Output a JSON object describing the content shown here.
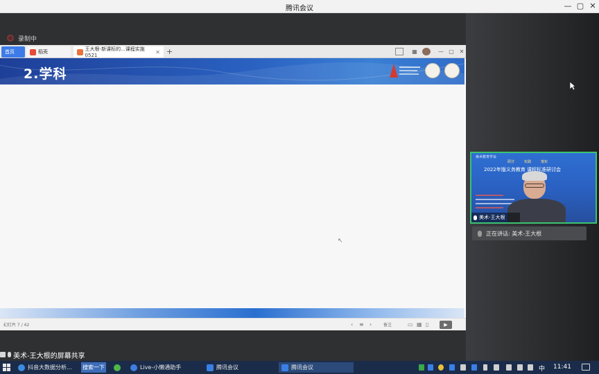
{
  "app": {
    "title": "腾讯会议",
    "controls": {
      "minimize": "—",
      "restore": "▢",
      "close": "✕"
    }
  },
  "meeting": {
    "recording_label": "录制中",
    "sharer_label": "美术-王大根的屏幕共享",
    "speaking_label": "正在讲话: 美术-王大根"
  },
  "browser": {
    "tabs": [
      {
        "label": "首页"
      },
      {
        "label": "稻壳"
      },
      {
        "label": "王大根-新课标的...课程实施0521"
      }
    ],
    "new_tab": "+",
    "win_controls": {
      "minimize": "—",
      "restore": "▢",
      "close": "✕"
    }
  },
  "slide": {
    "title": "2.学科",
    "page_indicator": "幻灯片 7 / 42",
    "notes_label": "备注"
  },
  "video": {
    "header_text": "美术教育学会",
    "tags": [
      "研讨",
      "实践",
      "落实"
    ],
    "title": "2022年版义务教育   课程标准研讨会",
    "name_label": "美术-王大根"
  },
  "taskbar": {
    "items": [
      {
        "label": "抖音大数据分析..."
      },
      {
        "label": "搜索一下"
      },
      {
        "label": "Live-小懒通助手"
      },
      {
        "label": "腾讯会议"
      },
      {
        "label": "腾讯会议"
      }
    ],
    "ime": "中",
    "time": "11:41"
  },
  "colors": {
    "accent_green": "#3cc36f",
    "banner_blue": "#2a62c2",
    "taskbar": "#1b2c4a"
  }
}
